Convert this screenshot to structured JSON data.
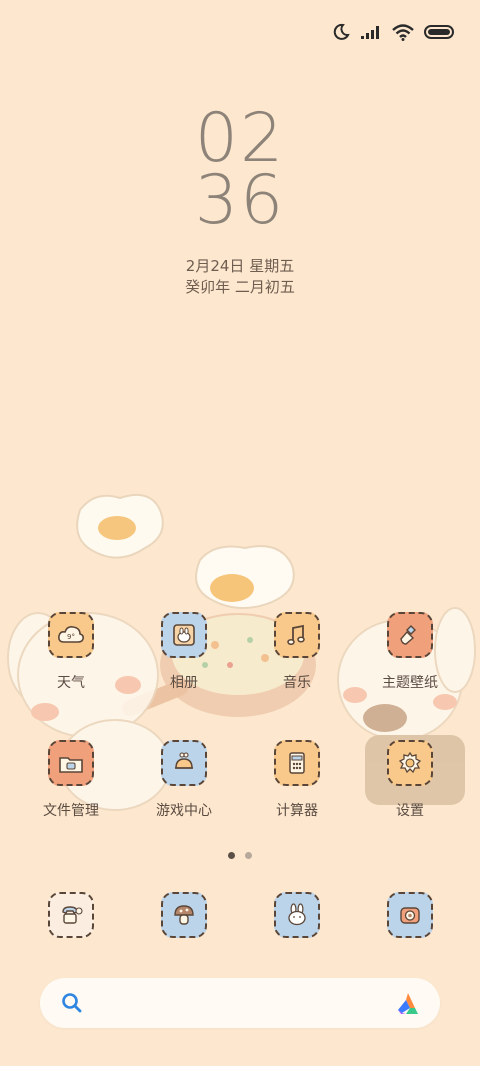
{
  "status_bar": {
    "icons": [
      "moon-icon",
      "signal-icon",
      "wifi-icon",
      "battery-icon"
    ]
  },
  "clock": {
    "hour": "02",
    "minute": "36",
    "date": "2月24日 星期五",
    "lunar": "癸卯年 二月初五"
  },
  "apps": [
    {
      "label": "天气",
      "icon": "weather-cloud-icon",
      "bg": "#f8c98a"
    },
    {
      "label": "相册",
      "icon": "photo-album-icon",
      "bg": "#bcd4ea"
    },
    {
      "label": "音乐",
      "icon": "music-note-icon",
      "bg": "#f8c98a"
    },
    {
      "label": "主题壁纸",
      "icon": "paint-brush-icon",
      "bg": "#f1a07c"
    },
    {
      "label": "文件管理",
      "icon": "folder-icon",
      "bg": "#f1a07c"
    },
    {
      "label": "游戏中心",
      "icon": "game-icon",
      "bg": "#bcd4ea"
    },
    {
      "label": "计算器",
      "icon": "calculator-icon",
      "bg": "#f8c98a"
    },
    {
      "label": "设置",
      "icon": "settings-egg-icon",
      "bg": "#f8c98a"
    }
  ],
  "page_indicator": {
    "count": 2,
    "active": 0
  },
  "dock": [
    {
      "icon": "phone-icon",
      "bg": "#fbeee0"
    },
    {
      "icon": "mushroom-browser-icon",
      "bg": "#bcd4ea"
    },
    {
      "icon": "bunny-messages-icon",
      "bg": "#bcd4ea"
    },
    {
      "icon": "camera-icon",
      "bg": "#bcd4ea"
    }
  ],
  "search": {
    "icons": [
      "search-icon",
      "assistant-icon"
    ]
  }
}
